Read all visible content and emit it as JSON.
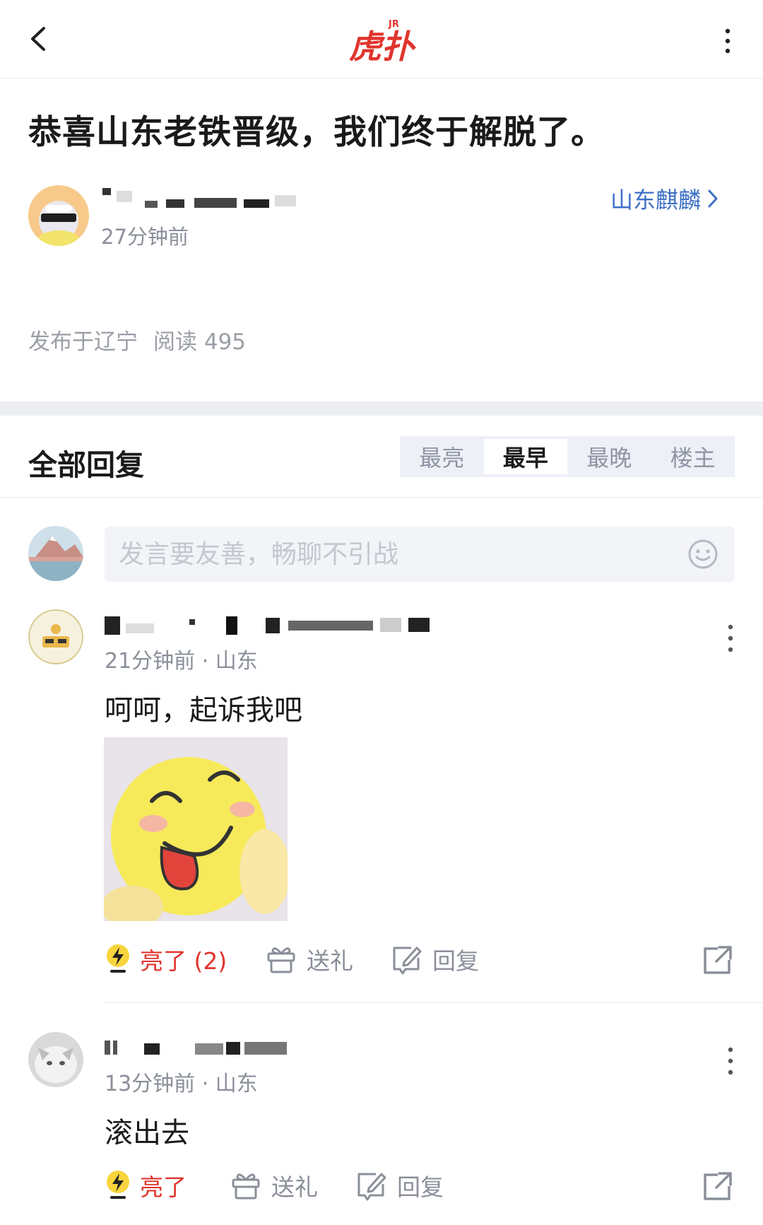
{
  "header": {
    "logo_text": "虎扑",
    "logo_badge": "JR"
  },
  "post": {
    "title": "恭喜山东老铁晋级，我们终于解脱了。",
    "time": "27分钟前",
    "board": "山东麒麟",
    "location": "发布于辽宁",
    "reads": "阅读 495"
  },
  "replies": {
    "title": "全部回复",
    "sort_tabs": [
      "最亮",
      "最早",
      "最晚",
      "楼主"
    ],
    "active_sort": "最早",
    "composer_placeholder": "发言要友善，畅聊不引战"
  },
  "comments": [
    {
      "meta": "21分钟前 · 山东",
      "text": "呵呵，起诉我吧",
      "like_label": "亮了 (2)",
      "gift_label": "送礼",
      "reply_label": "回复"
    },
    {
      "meta": "13分钟前 · 山东",
      "text": "滚出去",
      "like_label": "亮了",
      "gift_label": "送礼",
      "reply_label": "回复"
    }
  ],
  "colors": {
    "brand_red": "#e0342c",
    "link_blue": "#3d6fc4",
    "muted_gray": "#8a8f99"
  },
  "icons": [
    "back-icon",
    "more-vertical-icon",
    "chevron-right-icon",
    "emoji-icon",
    "lightning-icon",
    "gift-icon",
    "edit-reply-icon",
    "share-icon"
  ]
}
